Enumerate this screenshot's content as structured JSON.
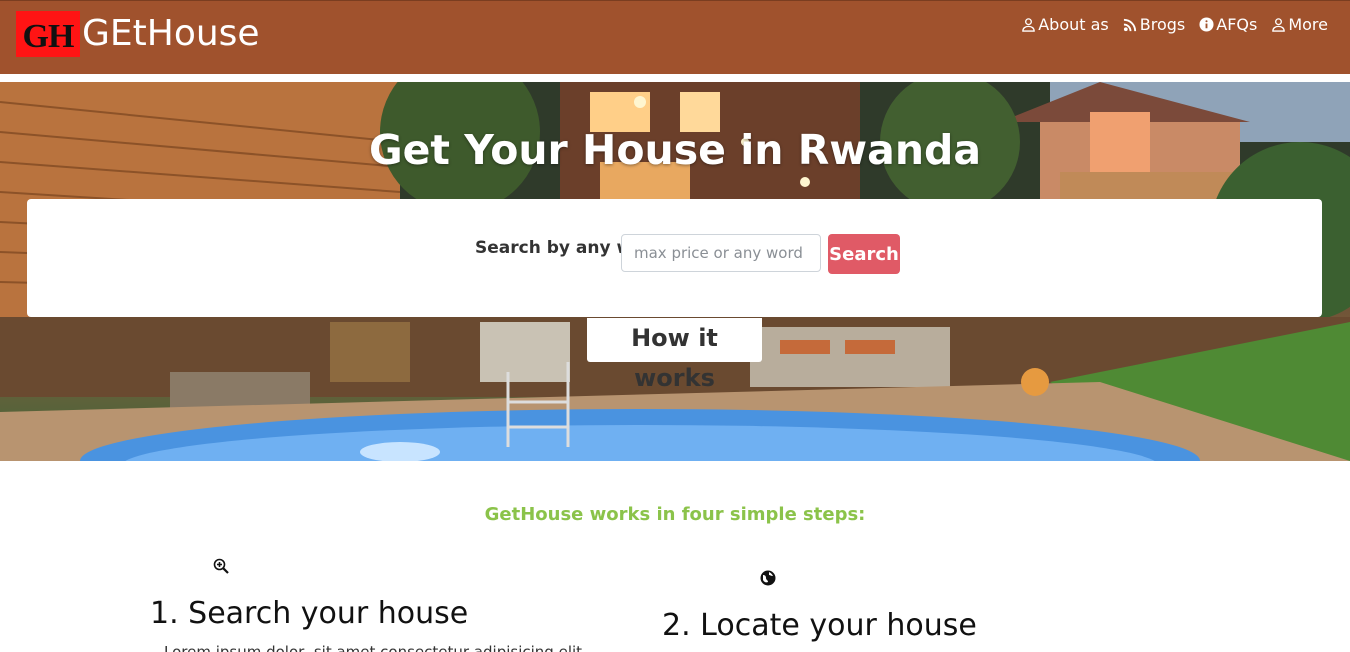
{
  "navbar": {
    "logo_text": "GH",
    "brand": "GEtHouse",
    "links": [
      {
        "label": "About as",
        "icon": "person-icon"
      },
      {
        "label": "Brogs",
        "icon": "rss-icon"
      },
      {
        "label": "AFQs",
        "icon": "info-circle-icon"
      },
      {
        "label": "More",
        "icon": "person-icon"
      }
    ]
  },
  "hero": {
    "title": "Get Your House in Rwanda",
    "search_label": "Search by any word",
    "search_placeholder": "max price or any word",
    "search_button": "Search",
    "how_it_works": "How it works"
  },
  "steps": {
    "heading": "GetHouse works in four simple steps:",
    "items": [
      {
        "title": "1. Search your house",
        "icon": "zoom-in-icon",
        "text": "Lorem ipsum dolor, sit amet consectetur adipisicing elit"
      },
      {
        "title": "2. Locate your house",
        "icon": "globe-icon"
      }
    ]
  },
  "colors": {
    "navbar": "#a0522d",
    "search_button": "#e05a66",
    "steps_heading": "#8bc34a"
  }
}
